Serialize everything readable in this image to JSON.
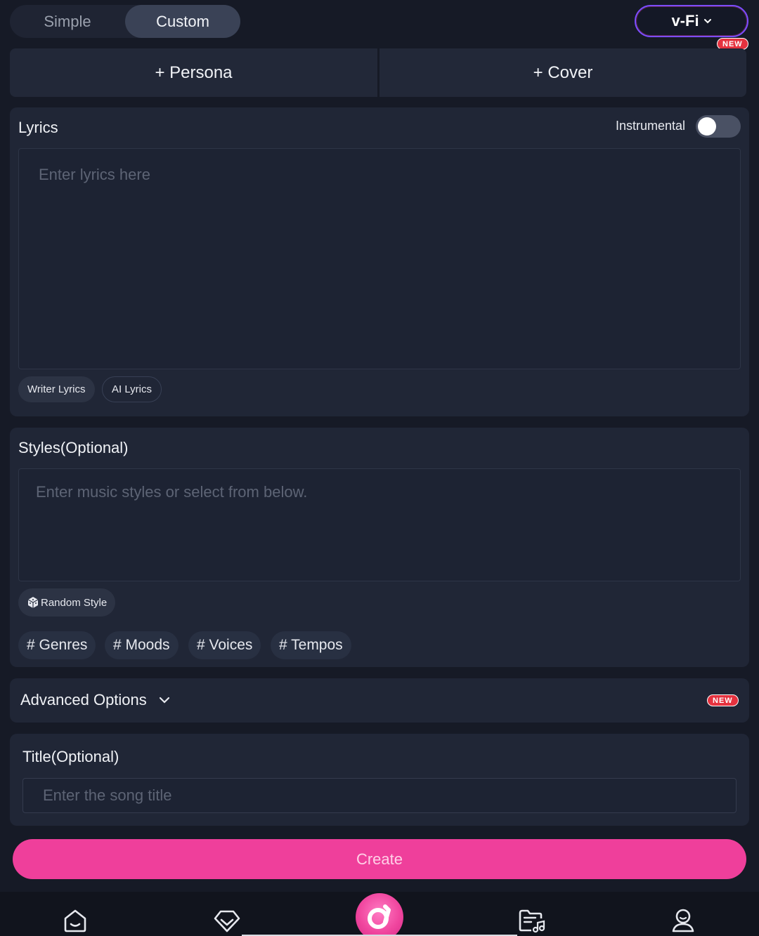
{
  "mode_switch": {
    "simple": "Simple",
    "custom": "Custom",
    "active": "Custom"
  },
  "model_select": {
    "label": "v-Fi",
    "badge": "NEW"
  },
  "actions": {
    "persona": "+ Persona",
    "cover": "+ Cover"
  },
  "lyrics": {
    "label": "Lyrics",
    "instrumental_label": "Instrumental",
    "instrumental_on": false,
    "placeholder": "Enter lyrics here",
    "buttons": [
      "Writer Lyrics",
      "AI Lyrics"
    ]
  },
  "styles": {
    "label": "Styles(Optional)",
    "placeholder": "Enter music styles or select from below.",
    "random_button": "Random Style",
    "tags": [
      "# Genres",
      "# Moods",
      "# Voices",
      "# Tempos"
    ]
  },
  "advanced": {
    "label": "Advanced Options",
    "badge": "NEW"
  },
  "title_section": {
    "label": "Title(Optional)",
    "placeholder": "Enter the song title"
  },
  "create_button": "Create",
  "colors": {
    "accent": "#ef3f9b",
    "model_border": "#7b4dff",
    "badge_red": "#e5323f"
  },
  "bottom_nav": [
    "home-icon",
    "diamond-icon",
    "create-logo-icon",
    "music-folder-icon",
    "profile-icon"
  ]
}
